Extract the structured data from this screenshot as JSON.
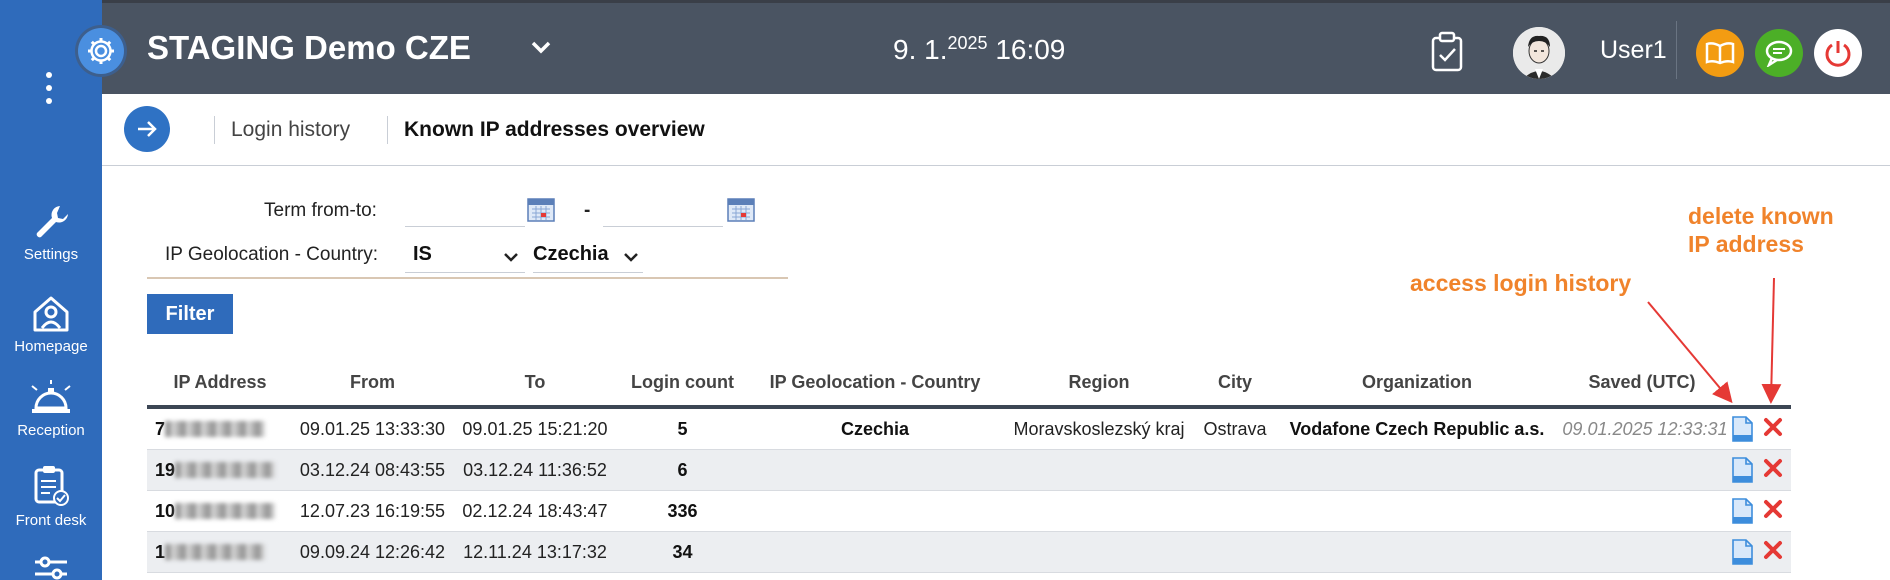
{
  "header": {
    "app_title": "STAGING Demo CZE",
    "date_main": "9. 1.",
    "date_year": "2025",
    "time": "16:09",
    "username": "User1"
  },
  "sidebar": {
    "items": [
      {
        "label": "Settings",
        "icon": "wrench-icon"
      },
      {
        "label": "Homepage",
        "icon": "home-person-icon"
      },
      {
        "label": "Reception",
        "icon": "service-bell-icon"
      },
      {
        "label": "Front desk",
        "icon": "clipboard-check-icon"
      }
    ]
  },
  "breadcrumb": {
    "items": [
      "Login history",
      "Known IP addresses overview"
    ]
  },
  "filter": {
    "term_label": "Term from-to:",
    "date_from": "",
    "dash": "-",
    "date_to": "",
    "country_label": "IP Geolocation - Country:",
    "country_code": "IS",
    "country_name": "Czechia",
    "button_label": "Filter"
  },
  "annotations": {
    "access": "access login history",
    "delete_line1": "delete known",
    "delete_line2": "IP address"
  },
  "table": {
    "columns": [
      "IP Address",
      "From",
      "To",
      "Login count",
      "IP Geolocation - Country",
      "Region",
      "City",
      "Organization",
      "Saved (UTC)"
    ],
    "rows": [
      {
        "ip_prefix": "7",
        "from": "09.01.25 13:33:30",
        "to": "09.01.25 15:21:20",
        "count": "5",
        "country": "Czechia",
        "region": "Moravskoslezský kraj",
        "city": "Ostrava",
        "org": "Vodafone Czech Republic a.s.",
        "saved": "09.01.2025 12:33:31"
      },
      {
        "ip_prefix": "19",
        "from": "03.12.24 08:43:55",
        "to": "03.12.24 11:36:52",
        "count": "6",
        "country": "",
        "region": "",
        "city": "",
        "org": "",
        "saved": ""
      },
      {
        "ip_prefix": "10",
        "from": "12.07.23 16:19:55",
        "to": "02.12.24 18:43:47",
        "count": "336",
        "country": "",
        "region": "",
        "city": "",
        "org": "",
        "saved": ""
      },
      {
        "ip_prefix": "1",
        "from": "09.09.24 12:26:42",
        "to": "12.11.24 13:17:32",
        "count": "34",
        "country": "",
        "region": "",
        "city": "",
        "org": "",
        "saved": ""
      }
    ]
  },
  "colors": {
    "sidebar": "#2f6bbb",
    "topbar": "#4a5462",
    "accent_orange": "#f0832b",
    "delete_red": "#e53935",
    "doc_blue": "#3d8ddc"
  }
}
